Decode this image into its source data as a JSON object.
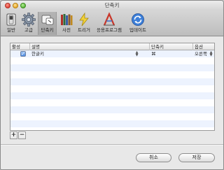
{
  "window": {
    "title": "단축키"
  },
  "toolbar": {
    "items": [
      {
        "label": "일반",
        "icon": "switch-icon"
      },
      {
        "label": "고급",
        "icon": "gear-icon"
      },
      {
        "label": "단축키",
        "icon": "shortcut-key-icon"
      },
      {
        "label": "사전",
        "icon": "books-icon"
      },
      {
        "label": "트리거",
        "icon": "lightning-icon"
      },
      {
        "label": "응용프로그램",
        "icon": "application-icon"
      },
      {
        "label": "업데이트",
        "icon": "update-icon"
      }
    ],
    "selected": "단축키"
  },
  "table": {
    "columns": [
      "활성",
      "설명",
      "단축키",
      "옵션"
    ],
    "rows": [
      {
        "enabled": true,
        "description": "한글키",
        "shortcut": "⌘",
        "option": "오른쪽"
      }
    ]
  },
  "list_controls": {
    "add": "+",
    "remove": "−"
  },
  "buttons": {
    "cancel": "취소",
    "save": "저장"
  }
}
